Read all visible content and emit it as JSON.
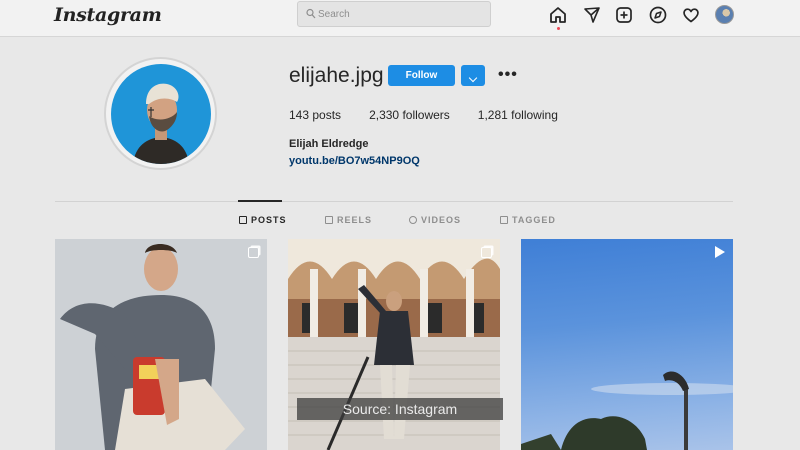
{
  "app": {
    "logo": "Instagram"
  },
  "search": {
    "placeholder": "Search"
  },
  "nav": {
    "icons": [
      "home-icon",
      "direct-icon",
      "new-post-icon",
      "explore-icon",
      "activity-icon",
      "profile-avatar"
    ]
  },
  "profile": {
    "username": "elijahe.jpg",
    "follow_label": "Follow",
    "more_label": "•••",
    "stats": [
      {
        "num": "143",
        "label": "posts"
      },
      {
        "num": "2,330",
        "label": "followers"
      },
      {
        "num": "1,281",
        "label": "following"
      }
    ],
    "full_name": "Elijah Eldredge",
    "link": "youtu.be/BO7w54NP9OQ"
  },
  "tabs": [
    {
      "label": "POSTS",
      "active": true
    },
    {
      "label": "REELS",
      "active": false
    },
    {
      "label": "VIDEOS",
      "active": false
    },
    {
      "label": "TAGGED",
      "active": false
    }
  ],
  "overlay": {
    "caption": "Source: Instagram"
  },
  "colors": {
    "accent": "#1d8de4",
    "link": "#00376b",
    "notification": "#ed4956"
  }
}
